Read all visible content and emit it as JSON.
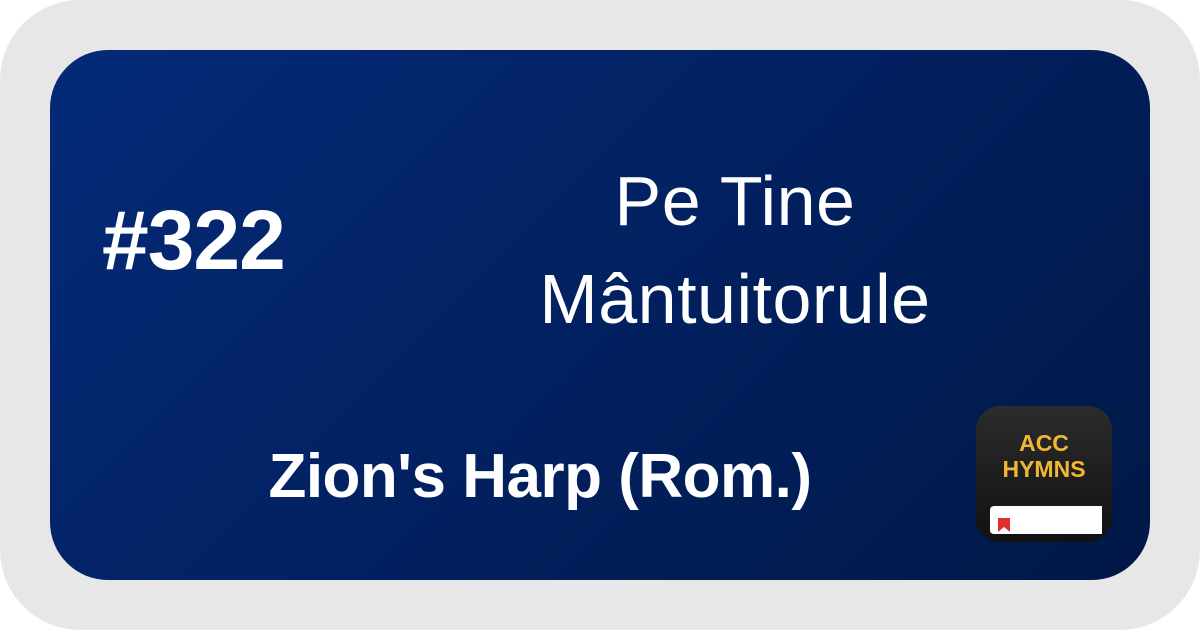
{
  "hymn": {
    "number": "#322",
    "title_line1": "Pe Tine",
    "title_line2": "Mântuitorule",
    "hymnal": "Zion's Harp (Rom.)"
  },
  "app_icon": {
    "line1": "ACC",
    "line2": "HYMNS",
    "icon_name": "acc-hymns-app-icon"
  },
  "colors": {
    "card_bg": "#02205e",
    "frame_bg": "#e7e7e7",
    "text": "#ffffff",
    "icon_accent": "#f2b632",
    "bookmark": "#e03030"
  }
}
